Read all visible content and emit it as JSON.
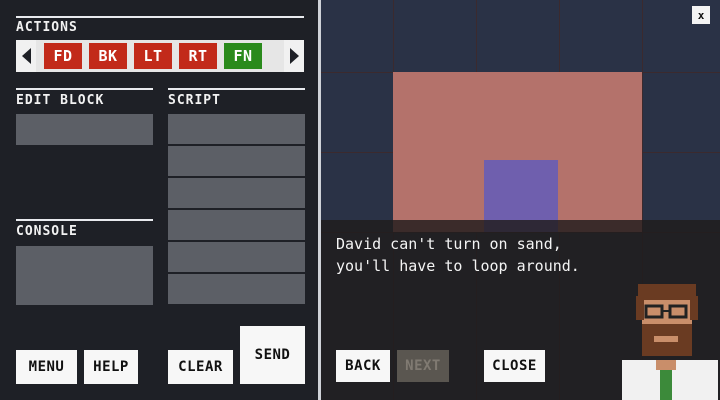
{
  "panel": {
    "actions_label": "ACTIONS",
    "edit_block_label": "EDIT BLOCK",
    "script_label": "SCRIPT",
    "console_label": "CONSOLE"
  },
  "actions": [
    {
      "code": "FD",
      "color": "#c22a1a"
    },
    {
      "code": "BK",
      "color": "#c22a1a"
    },
    {
      "code": "LT",
      "color": "#c22a1a"
    },
    {
      "code": "RT",
      "color": "#c22a1a"
    },
    {
      "code": "FN",
      "color": "#2a8a1c"
    }
  ],
  "buttons": {
    "menu": "MENU",
    "help": "HELP",
    "clear": "CLEAR",
    "send": "SEND"
  },
  "dialog": {
    "text": "David can't turn on sand,\nyou'll have to loop around.",
    "back": "BACK",
    "next": "NEXT",
    "close": "CLOSE"
  },
  "window": {
    "close_glyph": "x"
  },
  "colors": {
    "sand": "#b4726b",
    "water": "#2a3246",
    "goal": "#6f5fae"
  }
}
